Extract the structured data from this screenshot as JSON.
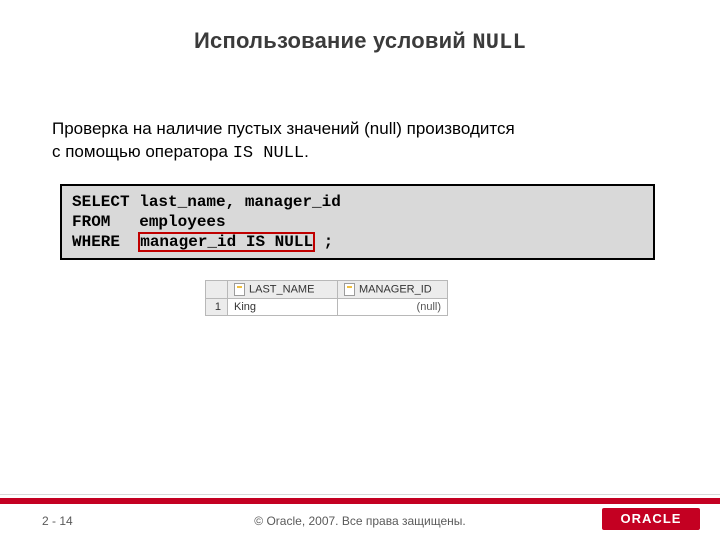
{
  "title": {
    "prefix": "Использование условий ",
    "mono": "NULL"
  },
  "body": {
    "line1": "Проверка на наличие пустых значений (null) производится",
    "line2_prefix": "с помощью оператора ",
    "line2_mono": "IS NULL",
    "line2_suffix": "."
  },
  "code": {
    "l1": "SELECT last_name, manager_id",
    "l2": "FROM   employees",
    "l3_before": "WHERE  ",
    "l3_hl": "manager_id IS NULL",
    "l3_after": " ;"
  },
  "result": {
    "columns": [
      "LAST_NAME",
      "MANAGER_ID"
    ],
    "rows": [
      {
        "n": "1",
        "last_name": "King",
        "manager_id": "(null)"
      }
    ]
  },
  "footer": {
    "page": "2 - 14",
    "copyright": "© Oracle, 2007. Все права защищены.",
    "logo": "ORACLE"
  }
}
